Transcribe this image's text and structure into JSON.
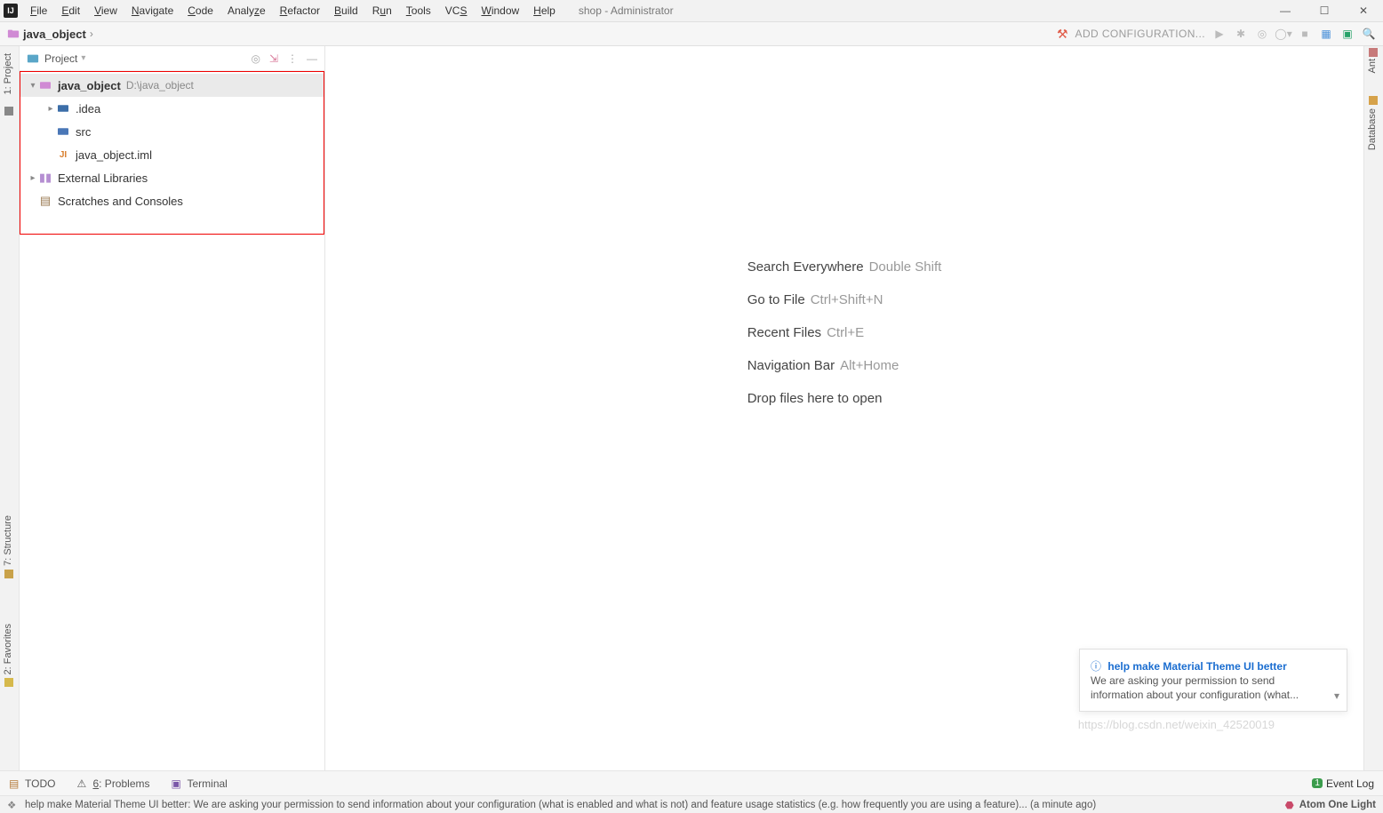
{
  "title": "shop - Administrator",
  "menus": [
    "File",
    "Edit",
    "View",
    "Navigate",
    "Code",
    "Analyze",
    "Refactor",
    "Build",
    "Run",
    "Tools",
    "VCS",
    "Window",
    "Help"
  ],
  "breadcrumb": {
    "project": "java_object"
  },
  "toolbar": {
    "add_config": "ADD CONFIGURATION..."
  },
  "project_panel": {
    "title": "Project",
    "root": {
      "name": "java_object",
      "path": "D:\\java_object"
    },
    "children": [
      {
        "name": ".idea",
        "expandable": true
      },
      {
        "name": "src",
        "expandable": false
      },
      {
        "name": "java_object.iml",
        "expandable": false
      }
    ],
    "siblings": [
      {
        "name": "External Libraries"
      },
      {
        "name": "Scratches and Consoles"
      }
    ]
  },
  "editor_placeholder": {
    "lines": [
      {
        "label": "Search Everywhere",
        "shortcut": "Double Shift"
      },
      {
        "label": "Go to File",
        "shortcut": "Ctrl+Shift+N"
      },
      {
        "label": "Recent Files",
        "shortcut": "Ctrl+E"
      },
      {
        "label": "Navigation Bar",
        "shortcut": "Alt+Home"
      },
      {
        "label": "Drop files here to open",
        "shortcut": ""
      }
    ]
  },
  "left_gutter": {
    "t1": "1: Project",
    "t2": "7: Structure",
    "t3": "2: Favorites"
  },
  "right_gutter": {
    "t1": "Ant",
    "t2": "Database"
  },
  "notification": {
    "title": "help make Material Theme UI better",
    "body": "We are asking your permission to send information about your configuration (what..."
  },
  "tool_strip": {
    "items": [
      "TODO",
      "6: Problems",
      "Terminal"
    ],
    "event_log": "Event Log",
    "event_badge": "1"
  },
  "statusbar": {
    "msg": "help make Material Theme UI better: We are asking your permission to send information about your configuration (what is enabled and what is not) and feature usage statistics (e.g. how frequently you are using a feature)... (a minute ago)",
    "theme": "Atom One Light"
  },
  "watermark": "https://blog.csdn.net/weixin_42520019"
}
